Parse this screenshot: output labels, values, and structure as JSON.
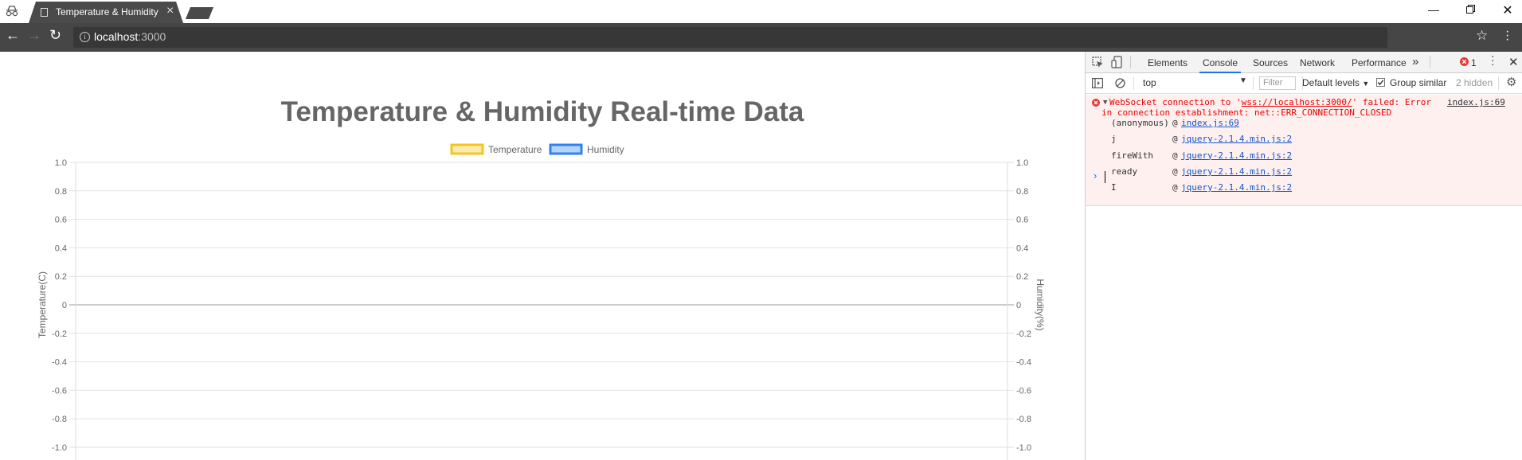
{
  "browser": {
    "tab_title": "Temperature & Humidity",
    "url_host": "localhost",
    "url_port": ":3000"
  },
  "chart": {
    "title": "Temperature & Humidity Real-time Data",
    "legend": [
      "Temperature",
      "Humidity"
    ]
  },
  "chart_data": {
    "type": "line",
    "title": "Temperature & Humidity Real-time Data",
    "series": [
      {
        "name": "Temperature",
        "values": [],
        "color": "#f4c51f"
      },
      {
        "name": "Humidity",
        "values": [],
        "color": "#2f83f0"
      }
    ],
    "ylabel": "Temperature(C)",
    "y2label": "Humidity(%)",
    "ylim": [
      -1.0,
      1.0
    ],
    "y2lim": [
      -1.0,
      1.0
    ],
    "yticks": [
      "1.0",
      "0.8",
      "0.6",
      "0.4",
      "0.2",
      "0",
      "-0.2",
      "-0.4",
      "-0.6",
      "-0.8",
      "-1.0"
    ],
    "grid": true,
    "legend_position": "top"
  },
  "devtools": {
    "tabs": [
      "Elements",
      "Console",
      "Sources",
      "Network",
      "Performance"
    ],
    "more": "»",
    "error_count": "1",
    "context": "top",
    "filter_placeholder": "Filter",
    "levels": "Default levels",
    "group_similar": "Group similar",
    "hidden": "2 hidden",
    "error": {
      "line1_prefix": "WebSocket connection to '",
      "line1_url": "wss://localhost:3000/",
      "line1_suffix": "' failed: Error",
      "line2": "in connection establishment: net::ERR_CONNECTION_CLOSED",
      "source": "index.js:69",
      "stack": [
        {
          "fn": "(anonymous)",
          "at": "@",
          "loc": "index.js:69"
        },
        {
          "fn": "j",
          "at": "@",
          "loc": "jquery-2.1.4.min.js:2"
        },
        {
          "fn": "fireWith",
          "at": "@",
          "loc": "jquery-2.1.4.min.js:2"
        },
        {
          "fn": "ready",
          "at": "@",
          "loc": "jquery-2.1.4.min.js:2"
        },
        {
          "fn": "I",
          "at": "@",
          "loc": "jquery-2.1.4.min.js:2"
        }
      ]
    },
    "prompt": "›"
  },
  "colors": {
    "tab_bg": "#4a4a4a",
    "toolbar_bg": "#464646",
    "omnibox_bg": "#373737",
    "error_text": "#e00000",
    "error_bg": "#fff0f0",
    "link": "#1155cc",
    "active_tab_accent": "#1a73e8",
    "chart_title": "#666666",
    "temperature": "#f4c51f",
    "humidity": "#2f83f0"
  }
}
